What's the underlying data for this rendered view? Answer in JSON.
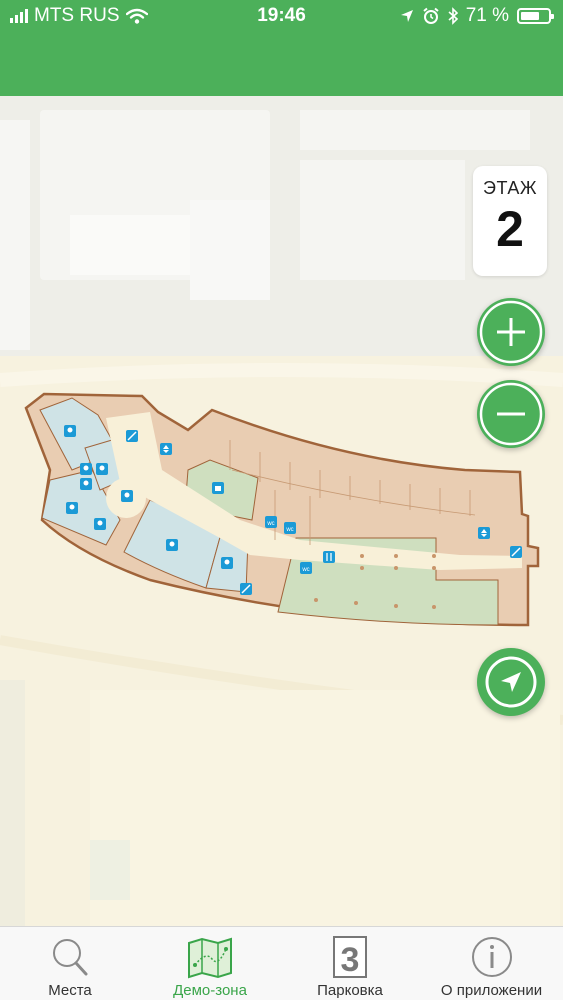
{
  "status_bar": {
    "carrier": "MTS RUS",
    "time": "19:46",
    "battery": "71 %",
    "battery_level": 0.71,
    "icons": [
      "signal-icon",
      "wifi-icon",
      "location-arrow-icon",
      "alarm-icon",
      "bluetooth-icon",
      "battery-icon"
    ]
  },
  "floor": {
    "label": "ЭТАЖ",
    "number": "2"
  },
  "controls": {
    "zoom_in": "plus-icon",
    "zoom_out": "minus-icon",
    "locate": "navigation-arrow-icon"
  },
  "map": {
    "poi_icons": [
      "pin-icon",
      "wc-icon",
      "restaurant-icon",
      "elevator-icon",
      "escalator-icon",
      "shop-icon"
    ]
  },
  "tabs": [
    {
      "label": "Места",
      "icon": "search-icon",
      "active": false
    },
    {
      "label": "Демо-зона",
      "icon": "map-icon",
      "active": true
    },
    {
      "label": "Парковка",
      "icon": "parking-number-icon",
      "active": false,
      "icon_text": "3"
    },
    {
      "label": "О приложении",
      "icon": "info-icon",
      "active": false
    }
  ],
  "colors": {
    "brand_green": "#4cb05a",
    "active_tab": "#3aa54a",
    "map_blue": "#cfe3e6",
    "map_beige": "#e8cdb0",
    "map_green": "#cfdfbf",
    "poi_blue": "#1b9ad6"
  }
}
